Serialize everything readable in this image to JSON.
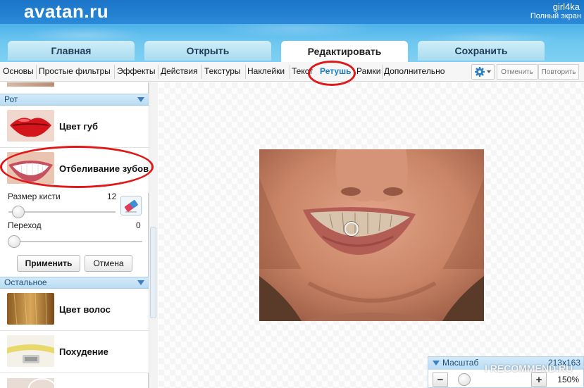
{
  "header": {
    "logo": "avatan.ru",
    "user": "girl4ka",
    "fullscreen": "Полный экран"
  },
  "tabs": [
    "Главная",
    "Открыть",
    "Редактировать",
    "Сохранить"
  ],
  "submenu": [
    "Основы",
    "Простые фильтры",
    "Эффекты",
    "Действия",
    "Текстуры",
    "Наклейки",
    "Текст",
    "Ретушь",
    "Рамки",
    "Дополнительно"
  ],
  "toolbar": {
    "undo": "Отменить",
    "redo": "Повторить",
    "settings_icon": "gear-icon"
  },
  "sidebar": {
    "mouth_section": "Рот",
    "mouth_tools": [
      "Цвет губ",
      "Отбеливание зубов"
    ],
    "brush_size_label": "Размер кисти",
    "brush_size_value": "12",
    "transition_label": "Переход",
    "transition_value": "0",
    "apply": "Применить",
    "cancel": "Отмена",
    "other_section": "Остальное",
    "other_tools": [
      "Цвет волос",
      "Похудение"
    ]
  },
  "zoom": {
    "label": "Масштаб",
    "size": "213x163",
    "minus": "−",
    "plus": "+",
    "value": "150%"
  },
  "watermark": "I RECOMMEND.RU",
  "colors": {
    "accent": "#1b7fbf",
    "annotation": "#e01818"
  }
}
